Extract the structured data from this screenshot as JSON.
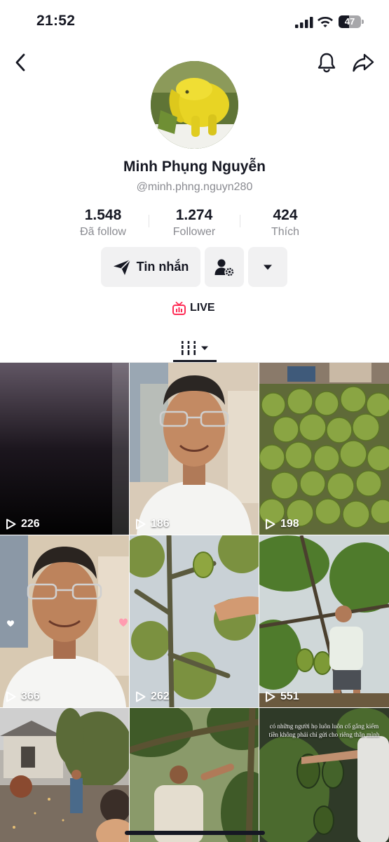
{
  "status_bar": {
    "time": "21:52",
    "battery_percent": "47",
    "battery_level": 0.47
  },
  "nav": {
    "back_icon": "chevron-left-icon",
    "bell_icon": "bell-icon",
    "share_icon": "share-arrow-icon"
  },
  "profile": {
    "name": "Minh Phụng Nguyễn",
    "handle": "@minh.phng.nguyn280"
  },
  "stats": {
    "following": {
      "value": "1.548",
      "label": "Đã follow"
    },
    "followers": {
      "value": "1.274",
      "label": "Follower"
    },
    "likes": {
      "value": "424",
      "label": "Thích"
    }
  },
  "actions": {
    "message_label": "Tin nhắn",
    "message_icon": "send-icon",
    "add_friend_icon": "user-gear-icon",
    "more_icon": "caret-down-icon"
  },
  "live": {
    "label": "LIVE",
    "icon": "live-tv-icon",
    "color": "#fe2c55"
  },
  "tabs": {
    "active_icon": "videos-grid-icon"
  },
  "videos": [
    {
      "views": "226"
    },
    {
      "views": "186"
    },
    {
      "views": "198"
    },
    {
      "views": "366"
    },
    {
      "views": "262"
    },
    {
      "views": "551"
    },
    {
      "views": ""
    },
    {
      "views": ""
    },
    {
      "views": "",
      "caption": "có những người họ luôn luôn cố gắng kiếm tiền không phải chỉ gửi cho riêng thân mình"
    }
  ]
}
